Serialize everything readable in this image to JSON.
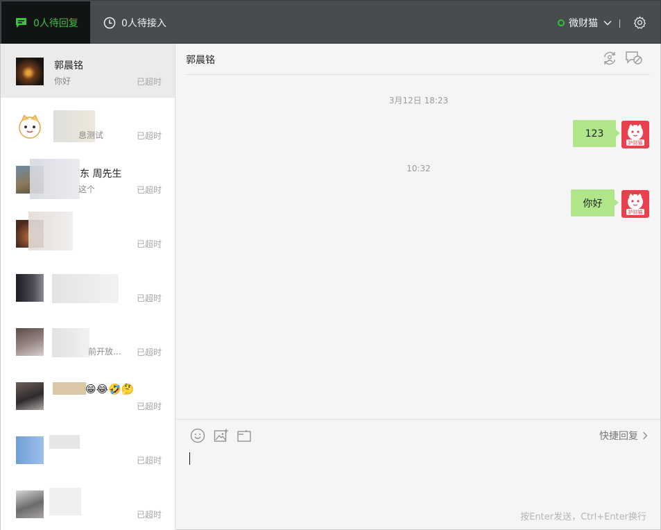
{
  "topbar": {
    "pending_reply": "0人待回复",
    "pending_accept": "0人待接入",
    "account_name": "微财猫",
    "status_color": "#2fc42f"
  },
  "conversations": [
    {
      "name": "郭晨铭",
      "preview": "你好",
      "status": "已超时",
      "active": true
    },
    {
      "name": "",
      "preview": "息测试",
      "status": "已超时"
    },
    {
      "name": "东 周先生",
      "preview": "这个",
      "status": "已超时"
    },
    {
      "name": "",
      "preview": "",
      "status": "已超时"
    },
    {
      "name": "",
      "preview": "",
      "status": "已超时"
    },
    {
      "name": "",
      "preview": "前开放...",
      "status": "已超时"
    },
    {
      "name": "",
      "preview": "",
      "status": "已超时"
    },
    {
      "name": "",
      "preview": "",
      "status": "已超时"
    },
    {
      "name": "",
      "preview": "",
      "status": "已超时"
    }
  ],
  "chat": {
    "contact_name": "郭晨铭",
    "messages": [
      {
        "time": "3月12日 18:23",
        "text": "123"
      },
      {
        "time": "10:32",
        "text": "你好"
      }
    ],
    "my_avatar_text": "护财猫"
  },
  "composer": {
    "quick_reply": "快捷回复",
    "hint": "按Enter发送，Ctrl+Enter换行"
  },
  "icons": {
    "chat": "chat-bubble-icon",
    "clock": "clock-icon",
    "chevron": "chevron-down-icon",
    "gear": "gear-icon",
    "transfer": "transfer-icon",
    "end": "end-chat-icon",
    "emoji": "emoji-icon",
    "image": "image-icon",
    "folder": "folder-icon"
  }
}
